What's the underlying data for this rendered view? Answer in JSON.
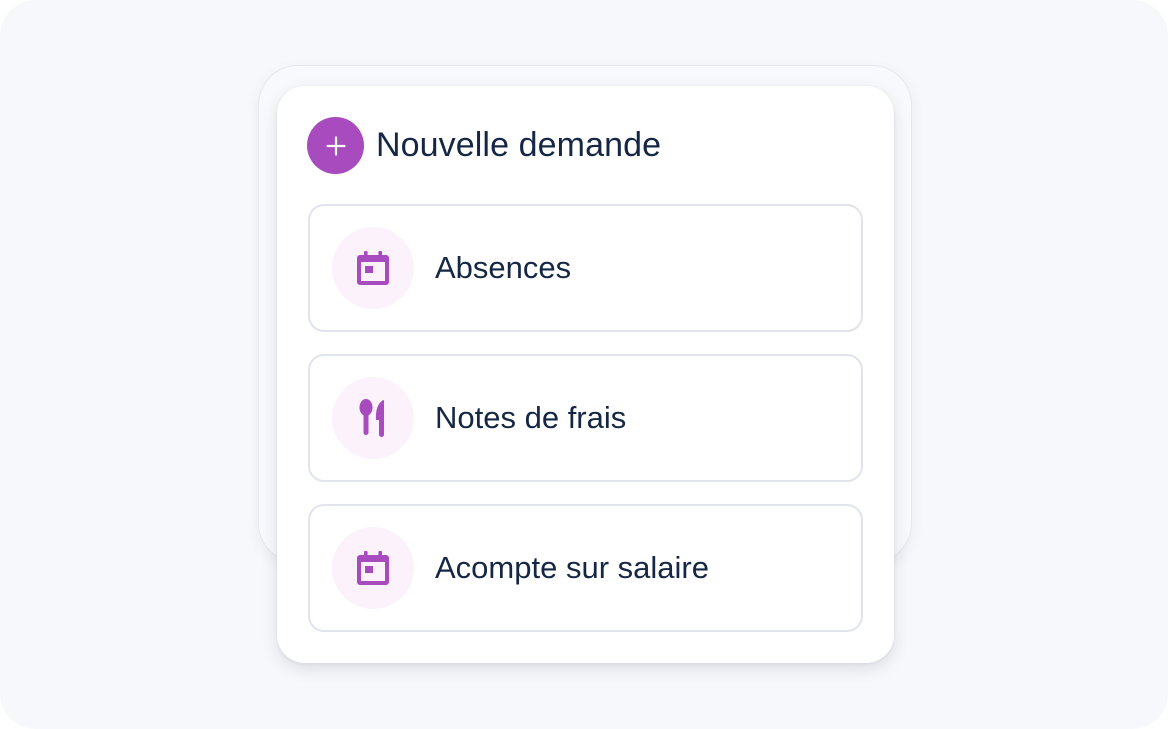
{
  "panel": {
    "title": "Nouvelle demande",
    "add_icon": "plus-icon",
    "accent_color": "#a74bbf",
    "options": [
      {
        "label": "Absences",
        "icon": "calendar-icon"
      },
      {
        "label": "Notes de frais",
        "icon": "cutlery-icon"
      },
      {
        "label": "Acompte sur salaire",
        "icon": "calendar-icon"
      }
    ]
  }
}
